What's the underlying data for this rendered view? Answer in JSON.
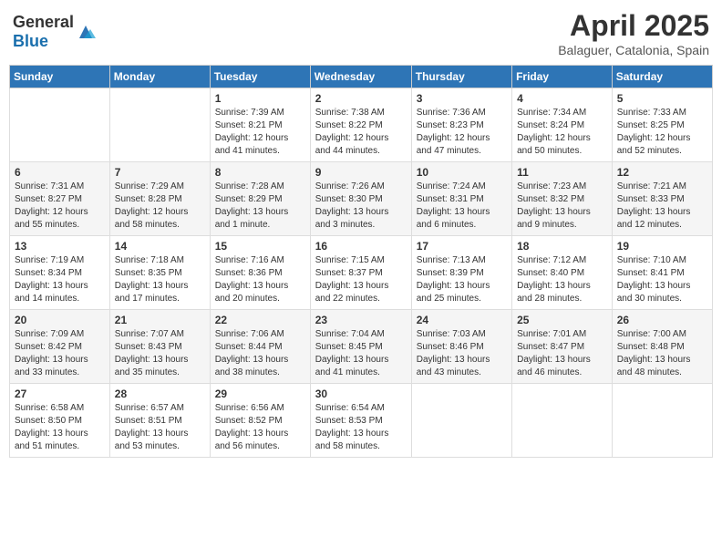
{
  "logo": {
    "text_general": "General",
    "text_blue": "Blue"
  },
  "header": {
    "month": "April 2025",
    "location": "Balaguer, Catalonia, Spain"
  },
  "weekdays": [
    "Sunday",
    "Monday",
    "Tuesday",
    "Wednesday",
    "Thursday",
    "Friday",
    "Saturday"
  ],
  "weeks": [
    [
      null,
      null,
      {
        "day": "1",
        "sunrise": "Sunrise: 7:39 AM",
        "sunset": "Sunset: 8:21 PM",
        "daylight": "Daylight: 12 hours and 41 minutes."
      },
      {
        "day": "2",
        "sunrise": "Sunrise: 7:38 AM",
        "sunset": "Sunset: 8:22 PM",
        "daylight": "Daylight: 12 hours and 44 minutes."
      },
      {
        "day": "3",
        "sunrise": "Sunrise: 7:36 AM",
        "sunset": "Sunset: 8:23 PM",
        "daylight": "Daylight: 12 hours and 47 minutes."
      },
      {
        "day": "4",
        "sunrise": "Sunrise: 7:34 AM",
        "sunset": "Sunset: 8:24 PM",
        "daylight": "Daylight: 12 hours and 50 minutes."
      },
      {
        "day": "5",
        "sunrise": "Sunrise: 7:33 AM",
        "sunset": "Sunset: 8:25 PM",
        "daylight": "Daylight: 12 hours and 52 minutes."
      }
    ],
    [
      {
        "day": "6",
        "sunrise": "Sunrise: 7:31 AM",
        "sunset": "Sunset: 8:27 PM",
        "daylight": "Daylight: 12 hours and 55 minutes."
      },
      {
        "day": "7",
        "sunrise": "Sunrise: 7:29 AM",
        "sunset": "Sunset: 8:28 PM",
        "daylight": "Daylight: 12 hours and 58 minutes."
      },
      {
        "day": "8",
        "sunrise": "Sunrise: 7:28 AM",
        "sunset": "Sunset: 8:29 PM",
        "daylight": "Daylight: 13 hours and 1 minute."
      },
      {
        "day": "9",
        "sunrise": "Sunrise: 7:26 AM",
        "sunset": "Sunset: 8:30 PM",
        "daylight": "Daylight: 13 hours and 3 minutes."
      },
      {
        "day": "10",
        "sunrise": "Sunrise: 7:24 AM",
        "sunset": "Sunset: 8:31 PM",
        "daylight": "Daylight: 13 hours and 6 minutes."
      },
      {
        "day": "11",
        "sunrise": "Sunrise: 7:23 AM",
        "sunset": "Sunset: 8:32 PM",
        "daylight": "Daylight: 13 hours and 9 minutes."
      },
      {
        "day": "12",
        "sunrise": "Sunrise: 7:21 AM",
        "sunset": "Sunset: 8:33 PM",
        "daylight": "Daylight: 13 hours and 12 minutes."
      }
    ],
    [
      {
        "day": "13",
        "sunrise": "Sunrise: 7:19 AM",
        "sunset": "Sunset: 8:34 PM",
        "daylight": "Daylight: 13 hours and 14 minutes."
      },
      {
        "day": "14",
        "sunrise": "Sunrise: 7:18 AM",
        "sunset": "Sunset: 8:35 PM",
        "daylight": "Daylight: 13 hours and 17 minutes."
      },
      {
        "day": "15",
        "sunrise": "Sunrise: 7:16 AM",
        "sunset": "Sunset: 8:36 PM",
        "daylight": "Daylight: 13 hours and 20 minutes."
      },
      {
        "day": "16",
        "sunrise": "Sunrise: 7:15 AM",
        "sunset": "Sunset: 8:37 PM",
        "daylight": "Daylight: 13 hours and 22 minutes."
      },
      {
        "day": "17",
        "sunrise": "Sunrise: 7:13 AM",
        "sunset": "Sunset: 8:39 PM",
        "daylight": "Daylight: 13 hours and 25 minutes."
      },
      {
        "day": "18",
        "sunrise": "Sunrise: 7:12 AM",
        "sunset": "Sunset: 8:40 PM",
        "daylight": "Daylight: 13 hours and 28 minutes."
      },
      {
        "day": "19",
        "sunrise": "Sunrise: 7:10 AM",
        "sunset": "Sunset: 8:41 PM",
        "daylight": "Daylight: 13 hours and 30 minutes."
      }
    ],
    [
      {
        "day": "20",
        "sunrise": "Sunrise: 7:09 AM",
        "sunset": "Sunset: 8:42 PM",
        "daylight": "Daylight: 13 hours and 33 minutes."
      },
      {
        "day": "21",
        "sunrise": "Sunrise: 7:07 AM",
        "sunset": "Sunset: 8:43 PM",
        "daylight": "Daylight: 13 hours and 35 minutes."
      },
      {
        "day": "22",
        "sunrise": "Sunrise: 7:06 AM",
        "sunset": "Sunset: 8:44 PM",
        "daylight": "Daylight: 13 hours and 38 minutes."
      },
      {
        "day": "23",
        "sunrise": "Sunrise: 7:04 AM",
        "sunset": "Sunset: 8:45 PM",
        "daylight": "Daylight: 13 hours and 41 minutes."
      },
      {
        "day": "24",
        "sunrise": "Sunrise: 7:03 AM",
        "sunset": "Sunset: 8:46 PM",
        "daylight": "Daylight: 13 hours and 43 minutes."
      },
      {
        "day": "25",
        "sunrise": "Sunrise: 7:01 AM",
        "sunset": "Sunset: 8:47 PM",
        "daylight": "Daylight: 13 hours and 46 minutes."
      },
      {
        "day": "26",
        "sunrise": "Sunrise: 7:00 AM",
        "sunset": "Sunset: 8:48 PM",
        "daylight": "Daylight: 13 hours and 48 minutes."
      }
    ],
    [
      {
        "day": "27",
        "sunrise": "Sunrise: 6:58 AM",
        "sunset": "Sunset: 8:50 PM",
        "daylight": "Daylight: 13 hours and 51 minutes."
      },
      {
        "day": "28",
        "sunrise": "Sunrise: 6:57 AM",
        "sunset": "Sunset: 8:51 PM",
        "daylight": "Daylight: 13 hours and 53 minutes."
      },
      {
        "day": "29",
        "sunrise": "Sunrise: 6:56 AM",
        "sunset": "Sunset: 8:52 PM",
        "daylight": "Daylight: 13 hours and 56 minutes."
      },
      {
        "day": "30",
        "sunrise": "Sunrise: 6:54 AM",
        "sunset": "Sunset: 8:53 PM",
        "daylight": "Daylight: 13 hours and 58 minutes."
      },
      null,
      null,
      null
    ]
  ]
}
